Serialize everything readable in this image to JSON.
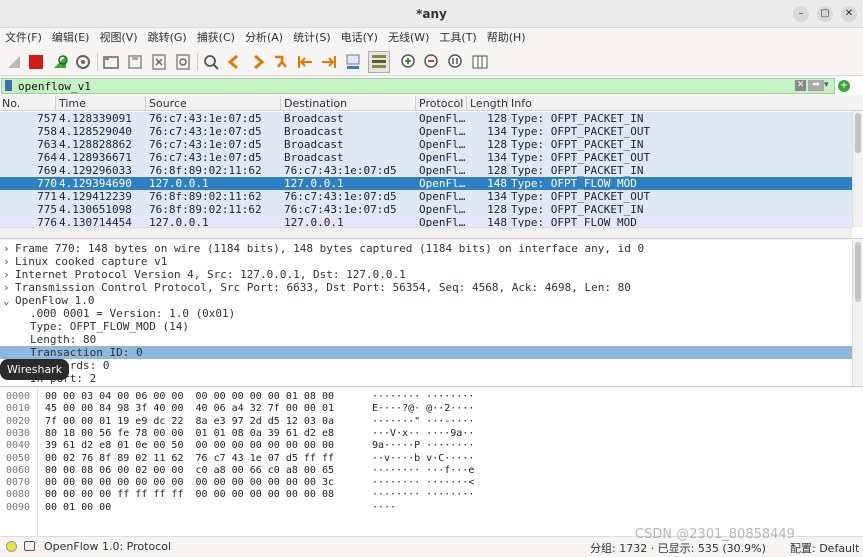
{
  "window": {
    "title": "*any"
  },
  "menu": [
    "文件(F)",
    "编辑(E)",
    "视图(V)",
    "跳转(G)",
    "捕获(C)",
    "分析(A)",
    "统计(S)",
    "电话(Y)",
    "无线(W)",
    "工具(T)",
    "帮助(H)"
  ],
  "filter": {
    "value": "openflow_v1"
  },
  "columns": [
    "No.",
    "Time",
    "Source",
    "Destination",
    "Protocol",
    "Length",
    "Info"
  ],
  "packets": [
    {
      "no": "757",
      "time": "4.128339091",
      "src": "76:c7:43:1e:07:d5",
      "dst": "Broadcast",
      "proto": "OpenFl…",
      "len": "128",
      "info": "Type: OFPT_PACKET_IN"
    },
    {
      "no": "758",
      "time": "4.128529040",
      "src": "76:c7:43:1e:07:d5",
      "dst": "Broadcast",
      "proto": "OpenFl…",
      "len": "134",
      "info": "Type: OFPT_PACKET_OUT"
    },
    {
      "no": "763",
      "time": "4.128828862",
      "src": "76:c7:43:1e:07:d5",
      "dst": "Broadcast",
      "proto": "OpenFl…",
      "len": "128",
      "info": "Type: OFPT_PACKET_IN"
    },
    {
      "no": "764",
      "time": "4.128936671",
      "src": "76:c7:43:1e:07:d5",
      "dst": "Broadcast",
      "proto": "OpenFl…",
      "len": "134",
      "info": "Type: OFPT_PACKET_OUT"
    },
    {
      "no": "769",
      "time": "4.129296033",
      "src": "76:8f:89:02:11:62",
      "dst": "76:c7:43:1e:07:d5",
      "proto": "OpenFl…",
      "len": "128",
      "info": "Type: OFPT_PACKET_IN"
    },
    {
      "no": "770",
      "time": "4.129394690",
      "src": "127.0.0.1",
      "dst": "127.0.0.1",
      "proto": "OpenFl…",
      "len": "148",
      "info": "Type: OFPT_FLOW_MOD"
    },
    {
      "no": "771",
      "time": "4.129412239",
      "src": "76:8f:89:02:11:62",
      "dst": "76:c7:43:1e:07:d5",
      "proto": "OpenFl…",
      "len": "134",
      "info": "Type: OFPT_PACKET_OUT"
    },
    {
      "no": "775",
      "time": "4.130651098",
      "src": "76:8f:89:02:11:62",
      "dst": "76:c7:43:1e:07:d5",
      "proto": "OpenFl…",
      "len": "128",
      "info": "Type: OFPT_PACKET_IN"
    },
    {
      "no": "776",
      "time": "4.130714454",
      "src": "127.0.0.1",
      "dst": "127.0.0.1",
      "proto": "OpenFl…",
      "len": "148",
      "info": "Type: OFPT_FLOW_MOD"
    }
  ],
  "selected_packet": "770",
  "details": [
    {
      "prefix": "›",
      "text": "Frame 770: 148 bytes on wire (1184 bits), 148 bytes captured (1184 bits) on interface any, id 0"
    },
    {
      "prefix": "›",
      "text": "Linux cooked capture v1"
    },
    {
      "prefix": "›",
      "text": "Internet Protocol Version 4, Src: 127.0.0.1, Dst: 127.0.0.1"
    },
    {
      "prefix": "›",
      "text": "Transmission Control Protocol, Src Port: 6633, Dst Port: 56354, Seq: 4568, Ack: 4698, Len: 80"
    },
    {
      "prefix": "⌄",
      "text": "OpenFlow 1.0"
    },
    {
      "prefix": "",
      "text": ".000 0001 = Version: 1.0 (0x01)"
    },
    {
      "prefix": "",
      "text": "Type: OFPT_FLOW_MOD (14)"
    },
    {
      "prefix": "",
      "text": "Length: 80"
    },
    {
      "prefix": "",
      "text": "Transaction ID: 0"
    },
    {
      "prefix": "",
      "text": "Wildcards: 0"
    },
    {
      "prefix": "",
      "text": "In port: 2"
    }
  ],
  "tooltip": "Wireshark",
  "hex_dump": [
    {
      "off": "0000",
      "hex": "00 00 03 04 00 06 00 00  00 00 00 00 00 01 08 00",
      "ascii": "········ ········"
    },
    {
      "off": "0010",
      "hex": "45 00 00 84 98 3f 40 00  40 06 a4 32 7f 00 00 01",
      "ascii": "E····?@· @··2····"
    },
    {
      "off": "0020",
      "hex": "7f 00 00 01 19 e9 dc 22  8a e3 97 2d d5 12 03 0a",
      "ascii": "·······\" ···-····"
    },
    {
      "off": "0030",
      "hex": "80 18 00 56 fe 78 00 00  01 01 08 0a 39 61 d2 e8",
      "ascii": "···V·x·· ····9a··"
    },
    {
      "off": "0040",
      "hex": "39 61 d2 e8 01 0e 00 50  00 00 00 00 00 00 00 00",
      "ascii": "9a·····P ········"
    },
    {
      "off": "0050",
      "hex": "00 02 76 8f 89 02 11 62  76 c7 43 1e 07 d5 ff ff",
      "ascii": "··v····b v·C·····"
    },
    {
      "off": "0060",
      "hex": "00 00 08 06 00 02 00 00  c0 a8 00 66 c0 a8 00 65",
      "ascii": "········ ···f···e"
    },
    {
      "off": "0070",
      "hex": "00 00 00 00 00 00 00 00  00 00 00 00 00 00 00 3c",
      "ascii": "········ ·······<"
    },
    {
      "off": "0080",
      "hex": "00 00 00 00 ff ff ff ff  00 00 00 00 00 00 00 08",
      "ascii": "········ ········"
    },
    {
      "off": "0090",
      "hex": "00 01 00 00",
      "ascii": "····"
    }
  ],
  "status": {
    "left": "OpenFlow 1.0: Protocol",
    "packets": "分组: 1732 · 已显示: 535 (30.9%)",
    "profile": "配置: Default",
    "watermark": "CSDN @2301_80858449"
  },
  "colors": {
    "selected": "#2f7fc1",
    "row_default": "#e7e6ff",
    "row_alt": "#dfe9f5",
    "filter_ok": "#c6f1c2",
    "highlight": "#8fb8dc"
  },
  "icons": [
    "shark-fin-icon",
    "stop-icon",
    "restart-icon",
    "options-icon",
    "open-icon",
    "save-icon",
    "close-icon",
    "reload-icon",
    "find-icon",
    "go-back-icon",
    "go-forward-icon",
    "go-to-packet-icon",
    "first-packet-icon",
    "last-packet-icon",
    "autoscroll-icon",
    "colorize-icon",
    "zoom-in-icon",
    "zoom-out-icon",
    "normal-size-icon",
    "resize-columns-icon"
  ]
}
